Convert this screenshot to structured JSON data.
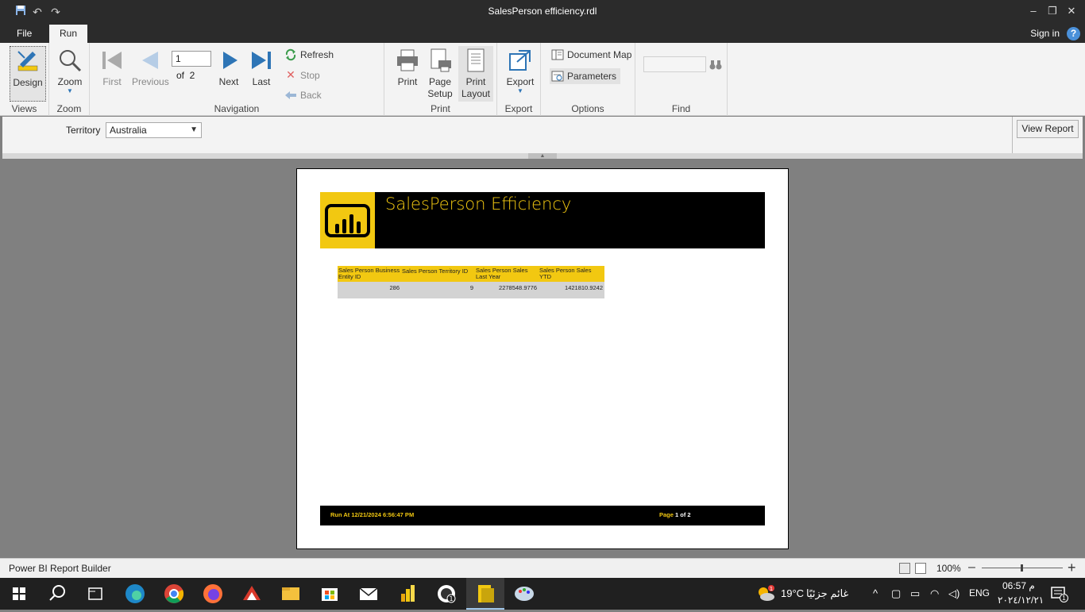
{
  "window": {
    "title": "SalesPerson efficiency.rdl"
  },
  "menu": {
    "file": "File",
    "run": "Run",
    "sign_in": "Sign in",
    "help": "?"
  },
  "ribbon": {
    "views": {
      "design": "Design",
      "group": "Views"
    },
    "zoom": {
      "zoom": "Zoom",
      "group": "Zoom"
    },
    "navigation": {
      "first": "First",
      "previous": "Previous",
      "page_value": "1",
      "of_label": "of  2",
      "next": "Next",
      "last": "Last",
      "refresh": "Refresh",
      "stop": "Stop",
      "back": "Back",
      "group": "Navigation"
    },
    "print": {
      "print": "Print",
      "page_setup_1": "Page",
      "page_setup_2": "Setup",
      "print_layout_1": "Print",
      "print_layout_2": "Layout",
      "group": "Print"
    },
    "export": {
      "export": "Export",
      "group": "Export"
    },
    "options": {
      "document_map": "Document Map",
      "parameters": "Parameters",
      "group": "Options"
    },
    "find": {
      "group": "Find"
    }
  },
  "parameters": {
    "territory_label": "Territory",
    "territory_value": "Australia",
    "view_report": "View Report"
  },
  "report": {
    "title": "SalesPerson Efficiency",
    "columns": [
      "Sales Person Business Entity ID",
      "Sales Person Territory ID",
      "Sales Person Sales Last Year",
      "Sales Person Sales YTD"
    ],
    "row": [
      "286",
      "9",
      "2278548.9776",
      "1421810.9242"
    ],
    "footer_run": "Run At 12/21/2024 6:56:47 PM",
    "footer_page_prefix": "Page ",
    "footer_page_num": "1 of 2"
  },
  "status": {
    "app": "Power BI Report Builder",
    "zoom": "100%"
  },
  "taskbar": {
    "weather_temp": "19°C",
    "weather_text": "غائم جزئيًا",
    "lang": "ENG",
    "time": "06:57 م",
    "date": "٢٠٢٤/١٢/٢١",
    "notif_count": "1"
  },
  "colors": {
    "accent": "#f2c811",
    "nav_blue": "#2e75b6"
  }
}
